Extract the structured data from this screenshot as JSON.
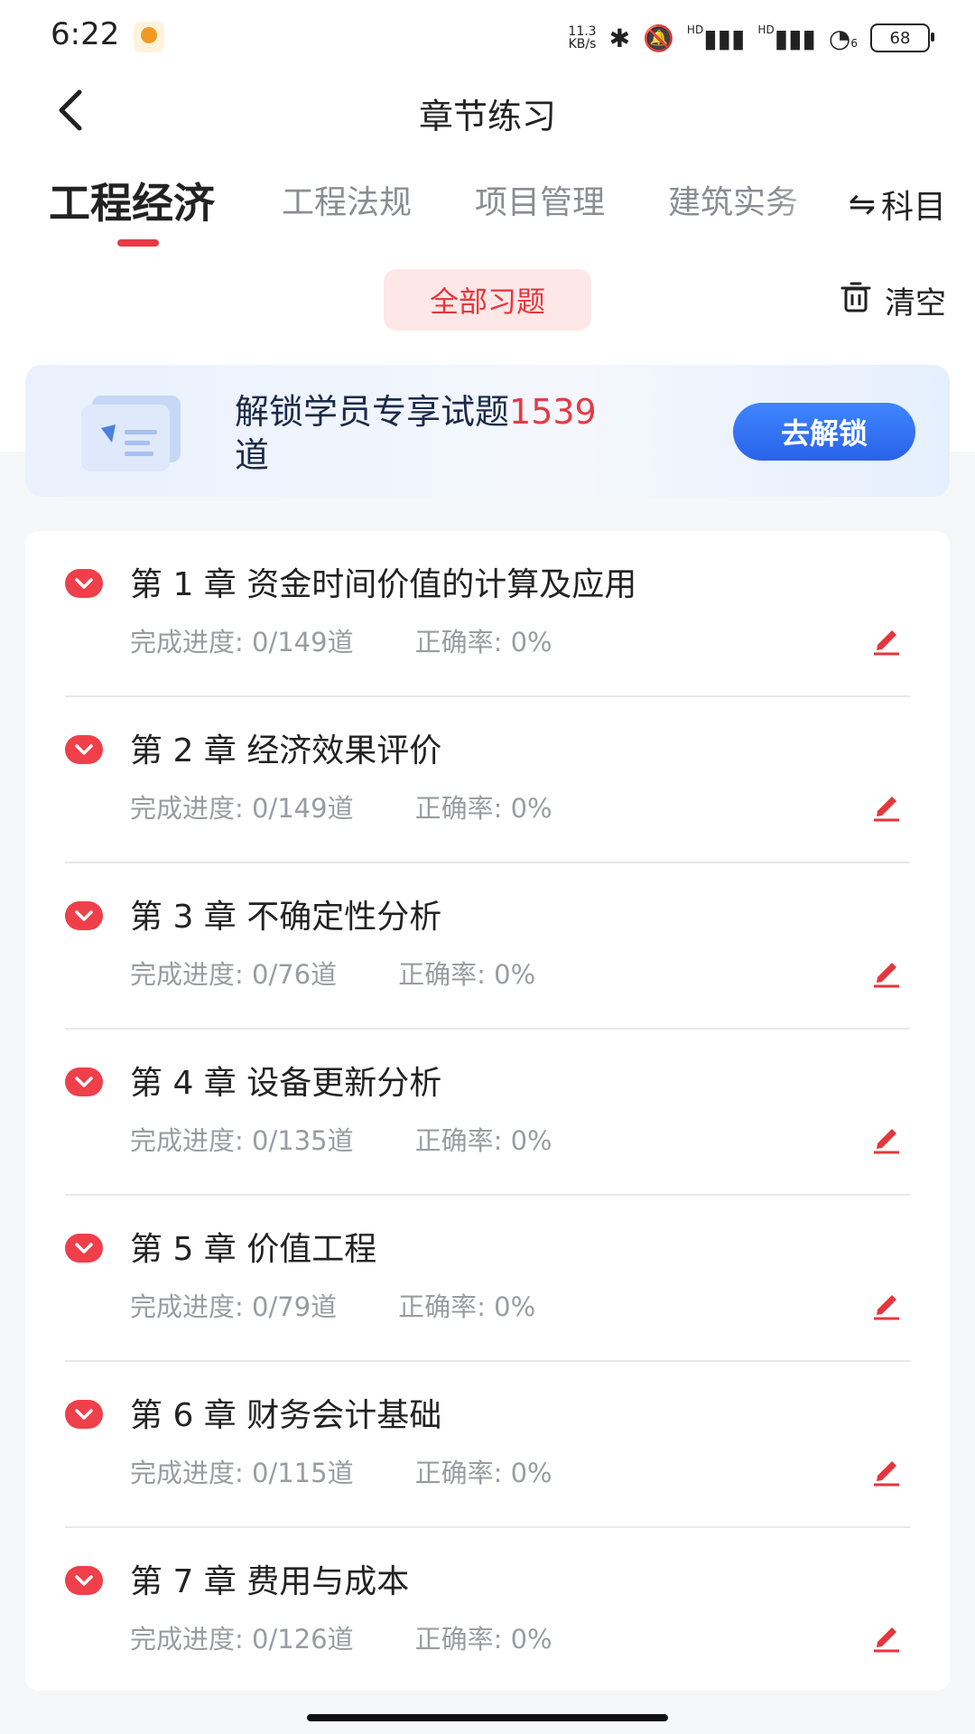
{
  "status_bar": {
    "time": "6:22",
    "network_speed_value": "11.3",
    "network_speed_unit": "KB/s",
    "signal_label_1": "HD",
    "signal_label_2": "HD",
    "wifi_label": "6",
    "battery": "68",
    "icons": [
      "bluetooth-icon",
      "mute-icon",
      "signal-icon",
      "signal-icon",
      "wifi-icon",
      "battery-icon"
    ]
  },
  "header": {
    "title": "章节练习",
    "tabs": [
      {
        "label": "工程经济",
        "active": true
      },
      {
        "label": "工程法规",
        "active": false
      },
      {
        "label": "项目管理",
        "active": false
      },
      {
        "label": "建筑实务",
        "active": false
      }
    ],
    "subject_switch_label": "科目",
    "filter_label": "全部习题",
    "clear_label": "清空"
  },
  "banner": {
    "text_before": "解锁学员专享试题",
    "count": "1539",
    "text_after": "道",
    "button_label": "去解锁"
  },
  "chapters": [
    {
      "title": "第 1 章  资金时间价值的计算及应用",
      "progress_label": "完成进度:",
      "progress": "0/149道",
      "accuracy_label": "正确率:",
      "accuracy": "0%"
    },
    {
      "title": "第 2 章  经济效果评价",
      "progress_label": "完成进度:",
      "progress": "0/149道",
      "accuracy_label": "正确率:",
      "accuracy": "0%"
    },
    {
      "title": "第 3 章  不确定性分析",
      "progress_label": "完成进度:",
      "progress": "0/76道",
      "accuracy_label": "正确率:",
      "accuracy": "0%"
    },
    {
      "title": "第 4 章  设备更新分析",
      "progress_label": "完成进度:",
      "progress": "0/135道",
      "accuracy_label": "正确率:",
      "accuracy": "0%"
    },
    {
      "title": "第 5 章  价值工程",
      "progress_label": "完成进度:",
      "progress": "0/79道",
      "accuracy_label": "正确率:",
      "accuracy": "0%"
    },
    {
      "title": "第 6 章  财务会计基础",
      "progress_label": "完成进度:",
      "progress": "0/115道",
      "accuracy_label": "正确率:",
      "accuracy": "0%"
    },
    {
      "title": "第 7 章  费用与成本",
      "progress_label": "完成进度:",
      "progress": "0/126道",
      "accuracy_label": "正确率:",
      "accuracy": "0%"
    }
  ],
  "colors": {
    "accent": "#e53b46",
    "button_blue": "#2f6ef0",
    "pill_bg": "#fde7e7"
  }
}
